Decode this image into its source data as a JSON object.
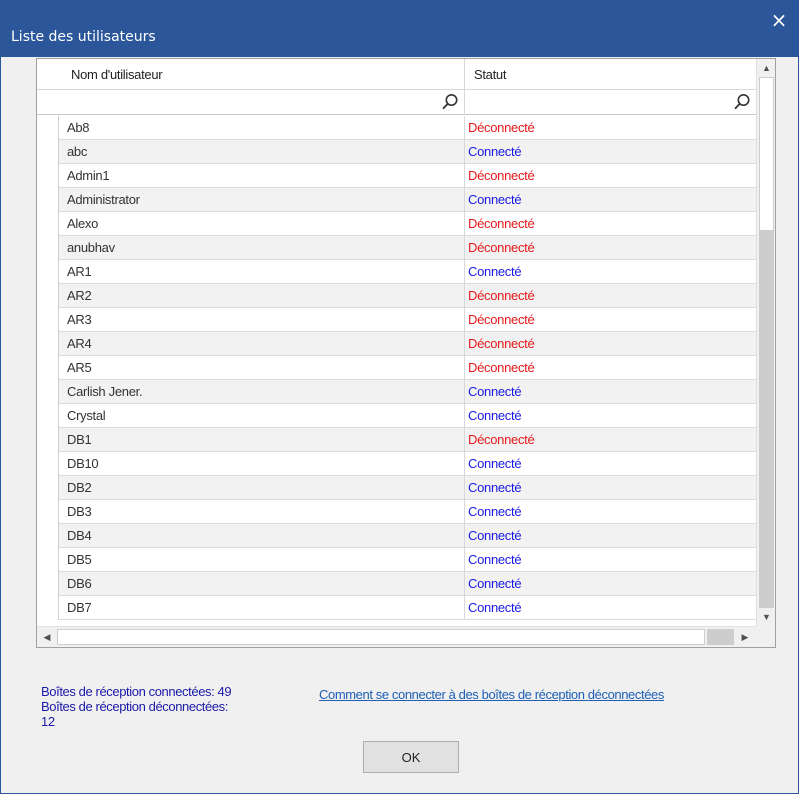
{
  "window": {
    "title": "Liste des utilisateurs",
    "close_label": "×"
  },
  "grid": {
    "columns": [
      "Nom d'utilisateur",
      "Statut"
    ],
    "filter_values": [
      "",
      ""
    ],
    "rows": [
      {
        "name": "Ab8",
        "status": "Déconnecté",
        "connected": false
      },
      {
        "name": "abc",
        "status": "Connecté",
        "connected": true
      },
      {
        "name": "Admin1",
        "status": "Déconnecté",
        "connected": false
      },
      {
        "name": "Administrator",
        "status": "Connecté",
        "connected": true
      },
      {
        "name": "Alexo",
        "status": "Déconnecté",
        "connected": false
      },
      {
        "name": "anubhav",
        "status": "Déconnecté",
        "connected": false
      },
      {
        "name": "AR1",
        "status": "Connecté",
        "connected": true
      },
      {
        "name": "AR2",
        "status": "Déconnecté",
        "connected": false
      },
      {
        "name": "AR3",
        "status": "Déconnecté",
        "connected": false
      },
      {
        "name": "AR4",
        "status": "Déconnecté",
        "connected": false
      },
      {
        "name": "AR5",
        "status": "Déconnecté",
        "connected": false
      },
      {
        "name": "Carlish Jener.",
        "status": "Connecté",
        "connected": true
      },
      {
        "name": "Crystal",
        "status": "Connecté",
        "connected": true
      },
      {
        "name": "DB1",
        "status": "Déconnecté",
        "connected": false
      },
      {
        "name": "DB10",
        "status": "Connecté",
        "connected": true
      },
      {
        "name": "DB2",
        "status": "Connecté",
        "connected": true
      },
      {
        "name": "DB3",
        "status": "Connecté",
        "connected": true
      },
      {
        "name": "DB4",
        "status": "Connecté",
        "connected": true
      },
      {
        "name": "DB5",
        "status": "Connecté",
        "connected": true
      },
      {
        "name": "DB6",
        "status": "Connecté",
        "connected": true
      },
      {
        "name": "DB7",
        "status": "Connecté",
        "connected": true
      }
    ]
  },
  "stats": {
    "connected_line": "Boîtes de réception connectées: 49",
    "disconnected_line": "Boîtes de réception déconnectées:",
    "disconnected_value": "12"
  },
  "help_link": "Comment se connecter à des boîtes de réception déconnectées",
  "ok_label": "OK",
  "colors": {
    "titlebar": "#2b579a",
    "connected": "#1a1ae6",
    "disconnected": "#e61a1a",
    "stats_text": "#1a1aa8",
    "link": "#1e5fb4"
  },
  "icons": {
    "search": "search-icon",
    "close": "close-icon",
    "scroll_up": "arrow-up-icon",
    "scroll_down": "arrow-down-icon",
    "scroll_left": "arrow-left-icon",
    "scroll_right": "arrow-right-icon"
  }
}
